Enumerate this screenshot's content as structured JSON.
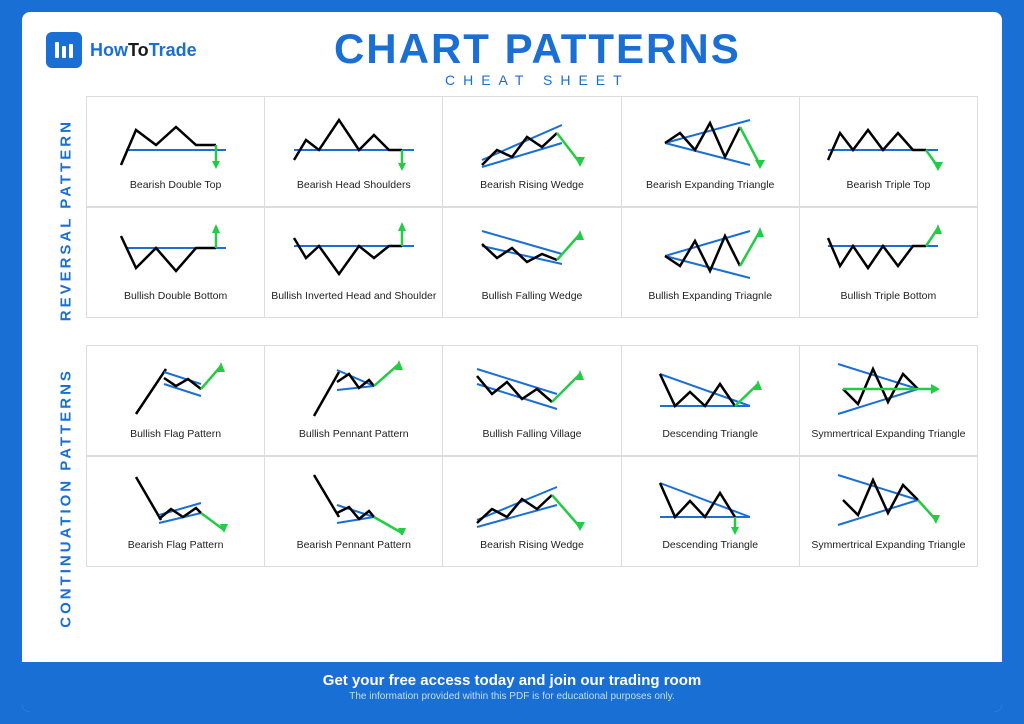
{
  "logo": {
    "text_how": "How",
    "text_to": "To",
    "text_trade": "Trade"
  },
  "title": "CHART PATTERNS",
  "subtitle": "CHEAT SHEET",
  "reversal_label": "REVERSAL PATTERN",
  "continuation_label": "CONTINUATION PATTERNS",
  "footer_main": "Get your free access today and join our trading room",
  "footer_sub": "The information provided within this PDF is for educational purposes only.",
  "reversal_row1": [
    "Bearish Double Top",
    "Bearish Head Shoulders",
    "Bearish Rising Wedge",
    "Bearish Expanding Triangle",
    "Bearish Triple Top"
  ],
  "reversal_row2": [
    "Bullish Double Bottom",
    "Bullish Inverted Head and Shoulder",
    "Bullish Falling Wedge",
    "Bullish Expanding Triagnle",
    "Bullish Triple Bottom"
  ],
  "continuation_row1": [
    "Bullish Flag Pattern",
    "Bullish Pennant Pattern",
    "Bullish Falling Village",
    "Descending Triangle",
    "Symmertrical Expanding Triangle"
  ],
  "continuation_row2": [
    "Bearish Flag Pattern",
    "Bearish Pennant Pattern",
    "Bearish Rising Wedge",
    "Descending Triangle",
    "Symmertrical Expanding Triangle"
  ]
}
